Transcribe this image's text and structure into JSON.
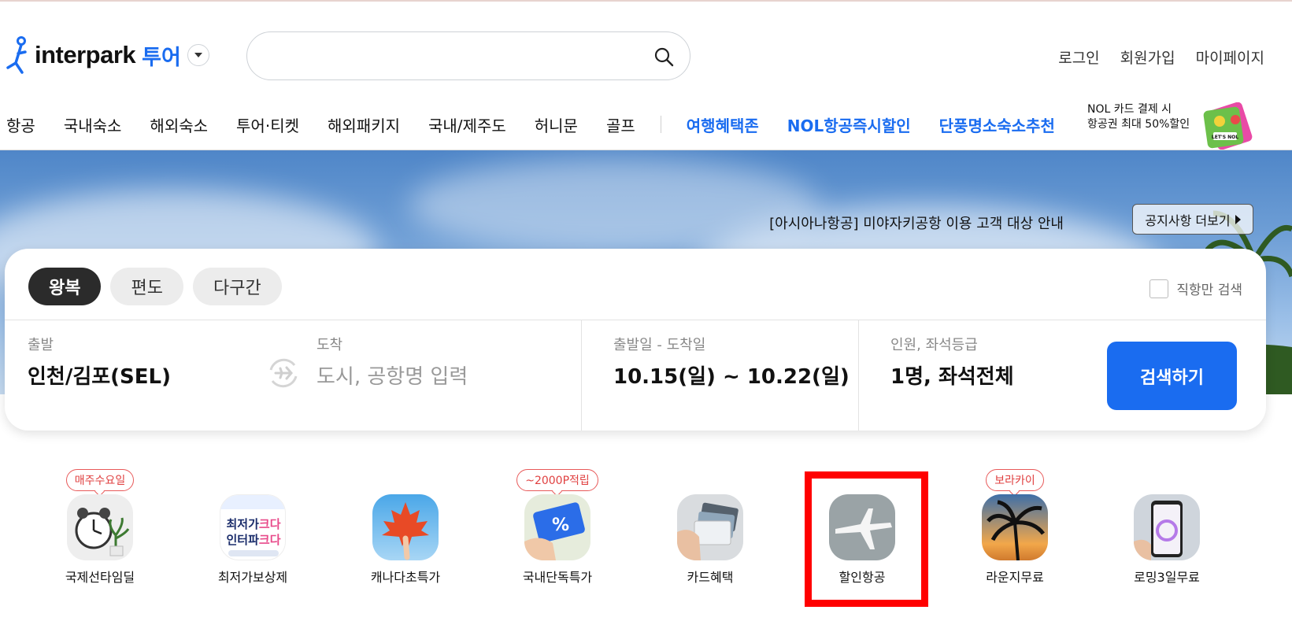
{
  "header": {
    "logo_text": "interpark",
    "logo_sub": "투어",
    "search_value": "",
    "search_placeholder": "",
    "util_links": [
      "로그인",
      "회원가입",
      "마이페이지"
    ]
  },
  "nav": {
    "items": [
      "항공",
      "국내숙소",
      "해외숙소",
      "투어·티켓",
      "해외패키지",
      "국내/제주도",
      "허니문",
      "골프"
    ],
    "special": [
      "여행혜택존",
      "NOL항공즉시할인",
      "단풍명소숙소추천"
    ],
    "promo_line1": "NOL 카드 결제 시",
    "promo_line2": "항공권 최대 50%할인",
    "promo_card_text": "LET'S NOL"
  },
  "banner": {
    "notice": "[아시아나항공] 미야자키공항 이용 고객 대상 안내",
    "notice_button": "공지사항 더보기"
  },
  "search_panel": {
    "trip_tabs": [
      "왕복",
      "편도",
      "다구간"
    ],
    "active_tab": "왕복",
    "direct_only": "직항만 검색",
    "from_label": "출발",
    "from_value": "인천/김포(SEL)",
    "to_label": "도착",
    "to_placeholder": "도시, 공항명 입력",
    "date_label": "출발일 - 도착일",
    "date_value": "10.15(일) ~ 10.22(일)",
    "pax_label": "인원, 좌석등급",
    "pax_value": "1명, 좌석전체",
    "search_button": "검색하기"
  },
  "quick_icons": [
    {
      "label": "국제선타임딜",
      "tag": "매주수요일",
      "image_text": ""
    },
    {
      "label": "최저가보상제",
      "tag": "",
      "image_text": "최저가크다 인터파크다"
    },
    {
      "label": "캐나다초특가",
      "tag": "",
      "image_text": ""
    },
    {
      "label": "국내단독특가",
      "tag": "~2000P적립",
      "image_text": "%"
    },
    {
      "label": "카드혜택",
      "tag": "",
      "image_text": ""
    },
    {
      "label": "할인항공",
      "tag": "",
      "image_text": ""
    },
    {
      "label": "라운지무료",
      "tag": "보라카이",
      "image_text": ""
    },
    {
      "label": "로밍3일무료",
      "tag": "",
      "image_text": ""
    }
  ],
  "colors": {
    "brand_blue": "#1a6cf0",
    "tag_red": "#e04040",
    "highlight_red": "#ff0000"
  }
}
